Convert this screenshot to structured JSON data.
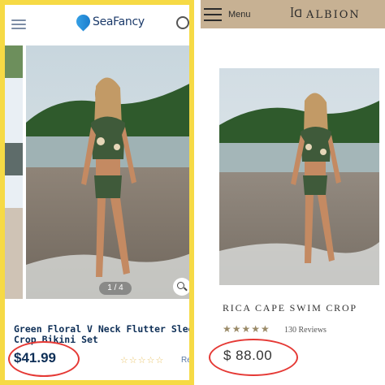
{
  "left": {
    "brand": "SeaFancy",
    "pager": "1 / 4",
    "title_line1": "Green Floral V Neck Flutter Sleev",
    "title_line2": "Crop Bikini Set",
    "price": "$41.99",
    "stars": "☆☆☆☆☆",
    "reviews_label": "Re",
    "icons": [
      "hamburger-menu-icon",
      "seafancy-logo-icon",
      "search-icon",
      "zoom-icon"
    ],
    "colors": {
      "frame": "#f6da45",
      "text": "#0e2f57",
      "highlight": "#e53935"
    }
  },
  "right": {
    "menu_label": "Menu",
    "brand_mark": "𝔖𝔄",
    "brand": "ALBION",
    "title": "RICA CAPE SWIM CROP",
    "stars": "★★★★★",
    "reviews": "130 Reviews",
    "price": "$ 88.00",
    "icons": [
      "hamburger-menu-icon",
      "albion-logo-icon"
    ],
    "colors": {
      "topbar": "#c7b193",
      "highlight": "#e53935"
    }
  }
}
